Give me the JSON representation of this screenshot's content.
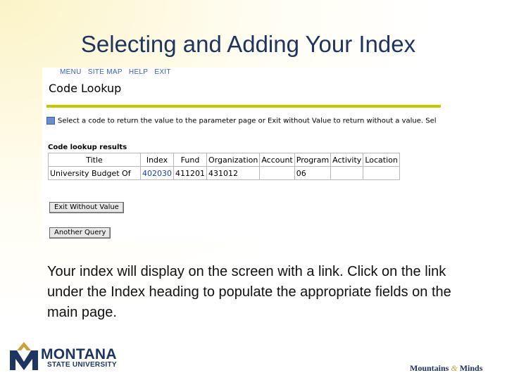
{
  "slide": {
    "title": "Selecting and Adding Your Index",
    "caption": "Your index will display on the screen with a link.  Click on the link under the Index heading to populate the appropriate fields on the main page."
  },
  "screenshot": {
    "nav": [
      "MENU",
      "SITE MAP",
      "HELP",
      "EXIT"
    ],
    "page_title": "Code Lookup",
    "info_text": "Select a code to return the value to the parameter page or Exit without Value to return without a value. Sel",
    "results_caption": "Code lookup results",
    "table": {
      "headers": [
        "Title",
        "Index",
        "Fund",
        "Organization",
        "Account",
        "Program",
        "Activity",
        "Location"
      ],
      "rows": [
        [
          "University Budget Of",
          "402030",
          "411201",
          "431012",
          "",
          "06",
          "",
          ""
        ]
      ]
    },
    "buttons": {
      "exit_without_value": "Exit Without Value",
      "another_query": "Another Query"
    }
  },
  "branding": {
    "logo_line1": "MONTANA",
    "logo_line2": "STATE UNIVERSITY",
    "tagline_a": "Mountains",
    "tagline_amp": "&",
    "tagline_b": "Minds",
    "colors": {
      "navy": "#1f3561",
      "gold": "#c9a23c",
      "link": "#1a3fb0",
      "rule": "#c8c800"
    }
  }
}
